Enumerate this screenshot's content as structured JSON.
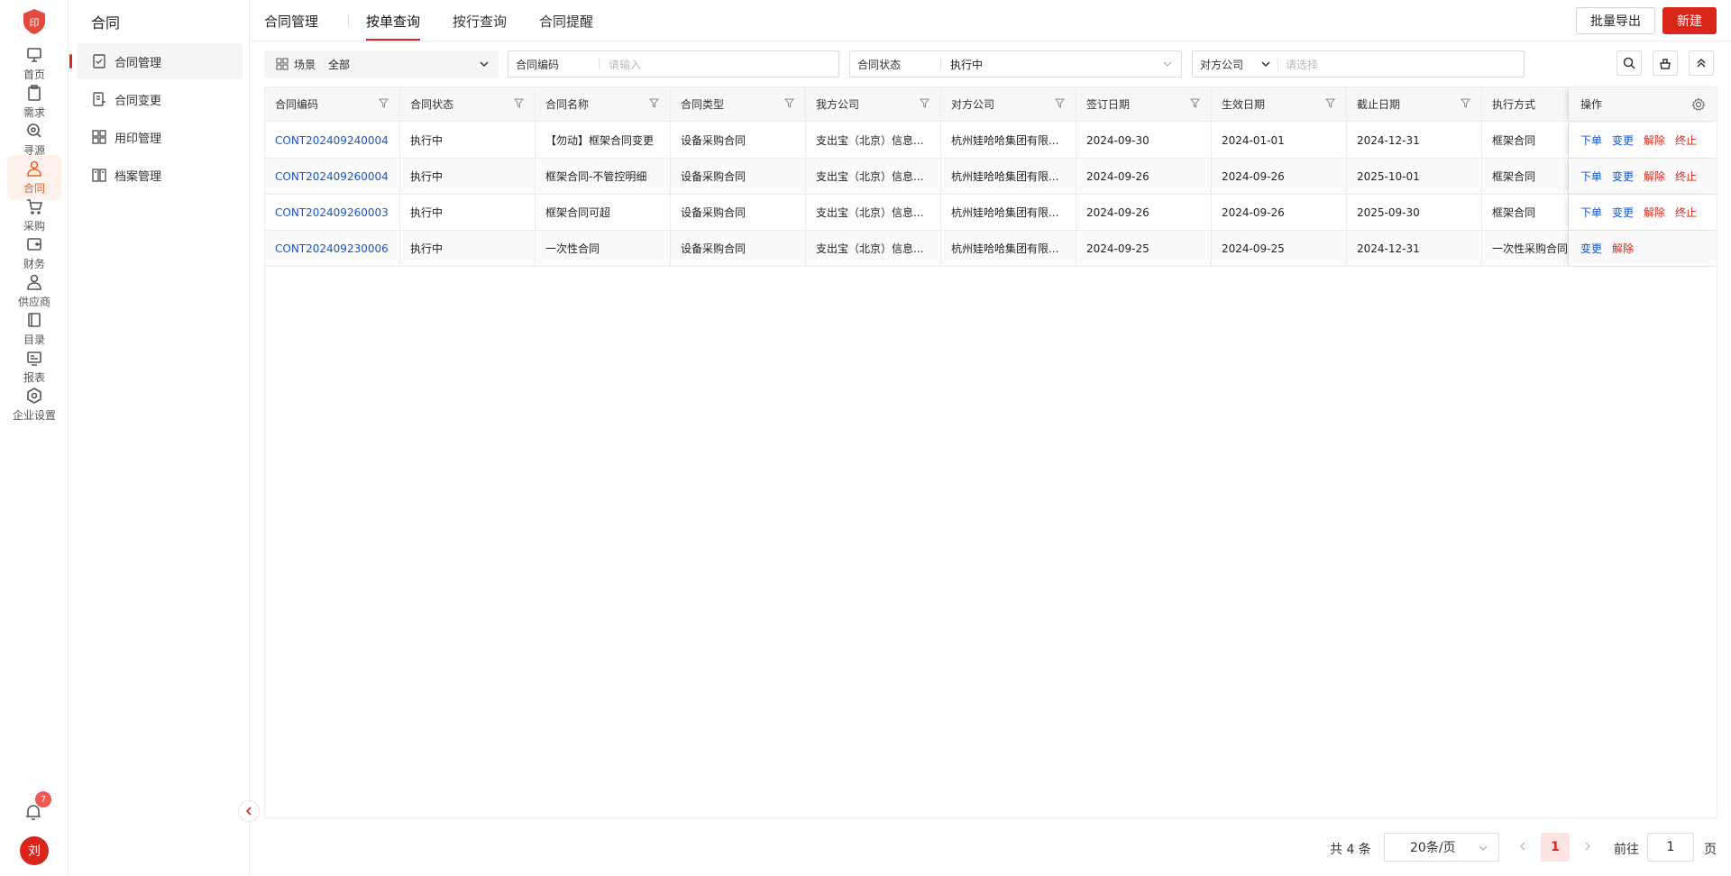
{
  "rail": {
    "logo_text": "印",
    "items": [
      {
        "label": "首页",
        "icon": "monitor-icon"
      },
      {
        "label": "需求",
        "icon": "clipboard-icon"
      },
      {
        "label": "寻源",
        "icon": "search-source-icon"
      },
      {
        "label": "合同",
        "icon": "contract-person-icon",
        "active": true
      },
      {
        "label": "采购",
        "icon": "cart-icon"
      },
      {
        "label": "财务",
        "icon": "wallet-icon"
      },
      {
        "label": "供应商",
        "icon": "supplier-icon"
      },
      {
        "label": "目录",
        "icon": "book-icon"
      },
      {
        "label": "报表",
        "icon": "report-icon"
      },
      {
        "label": "企业设置",
        "icon": "settings-hex-icon"
      }
    ],
    "notification_count": "7",
    "avatar_initial": "刘"
  },
  "sidebar": {
    "title": "合同",
    "items": [
      {
        "label": "合同管理",
        "active": true
      },
      {
        "label": "合同变更"
      },
      {
        "label": "用印管理"
      },
      {
        "label": "档案管理"
      }
    ]
  },
  "topbar": {
    "crumb": "合同管理",
    "tabs": [
      {
        "label": "按单查询",
        "active": true
      },
      {
        "label": "按行查询"
      },
      {
        "label": "合同提醒"
      }
    ],
    "export_label": "批量导出",
    "new_label": "新建"
  },
  "filters": {
    "scene_label": "场景",
    "scene_value": "全部",
    "code_label": "合同编码",
    "code_placeholder": "请输入",
    "status_label": "合同状态",
    "status_value": "执行中",
    "party_label": "对方公司",
    "party_placeholder": "请选择"
  },
  "table": {
    "columns": [
      "合同编码",
      "合同状态",
      "合同名称",
      "合同类型",
      "我方公司",
      "对方公司",
      "签订日期",
      "生效日期",
      "截止日期",
      "执行方式"
    ],
    "ops_header": "操作",
    "rows": [
      {
        "code": "CONT202409240004",
        "status": "执行中",
        "name": "【勿动】框架合同变更",
        "type": "设备采购合同",
        "our": "支出宝（北京）信息...",
        "party": "杭州娃哈哈集团有限...",
        "sign": "2024-09-30",
        "effective": "2024-01-01",
        "end": "2024-12-31",
        "mode": "框架合同",
        "ops": [
          {
            "label": "下单",
            "color": "blue"
          },
          {
            "label": "变更",
            "color": "blue"
          },
          {
            "label": "解除",
            "color": "red"
          },
          {
            "label": "终止",
            "color": "red"
          }
        ]
      },
      {
        "code": "CONT202409260004",
        "status": "执行中",
        "name": "框架合同-不管控明细",
        "type": "设备采购合同",
        "our": "支出宝（北京）信息...",
        "party": "杭州娃哈哈集团有限...",
        "sign": "2024-09-26",
        "effective": "2024-09-26",
        "end": "2025-10-01",
        "mode": "框架合同",
        "ops": [
          {
            "label": "下单",
            "color": "blue"
          },
          {
            "label": "变更",
            "color": "blue"
          },
          {
            "label": "解除",
            "color": "red"
          },
          {
            "label": "终止",
            "color": "red"
          }
        ]
      },
      {
        "code": "CONT202409260003",
        "status": "执行中",
        "name": "框架合同可超",
        "type": "设备采购合同",
        "our": "支出宝（北京）信息...",
        "party": "杭州娃哈哈集团有限...",
        "sign": "2024-09-26",
        "effective": "2024-09-26",
        "end": "2025-09-30",
        "mode": "框架合同",
        "ops": [
          {
            "label": "下单",
            "color": "blue"
          },
          {
            "label": "变更",
            "color": "blue"
          },
          {
            "label": "解除",
            "color": "red"
          },
          {
            "label": "终止",
            "color": "red"
          }
        ]
      },
      {
        "code": "CONT202409230006",
        "status": "执行中",
        "name": "一次性合同",
        "type": "设备采购合同",
        "our": "支出宝（北京）信息...",
        "party": "杭州娃哈哈集团有限...",
        "sign": "2024-09-25",
        "effective": "2024-09-25",
        "end": "2024-12-31",
        "mode": "一次性采购合同",
        "ops": [
          {
            "label": "变更",
            "color": "blue"
          },
          {
            "label": "解除",
            "color": "red"
          }
        ]
      }
    ]
  },
  "pager": {
    "total": "共 4 条",
    "page_size": "20条/页",
    "current": "1",
    "goto_label": "前往",
    "goto_value": "1",
    "page_suffix": "页"
  },
  "colors": {
    "accent": "#d9261c",
    "link": "#1a55c7",
    "active_rail": "#e8611f"
  }
}
